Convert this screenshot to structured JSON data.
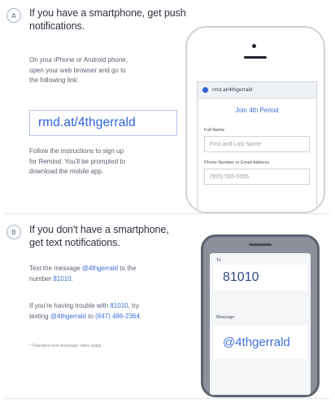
{
  "section_a": {
    "badge": "A",
    "heading_line1": "If you have a smartphone, get push",
    "heading_line2": "notifications.",
    "instr_line1": "On your iPhone or Android phone,",
    "instr_line2": "open your web browser and go to",
    "instr_line3": "the following link:",
    "link": "rmd.at/4thgerrald",
    "follow_line1": "Follow the instructions to sign up",
    "follow_line2": "for Remind. You'll be prompted to",
    "follow_line3": "download the mobile app.",
    "phone": {
      "url": "rmd.at/4thgerrald",
      "title": "Join 4th Period",
      "full_name_label": "Full Name",
      "full_name_placeholder": "First and Last Name",
      "contact_label": "Phone Number or Email Address",
      "contact_placeholder": "(555) 555-5555"
    }
  },
  "section_b": {
    "badge": "B",
    "heading_line1": "If you don't have a smartphone,",
    "heading_line2": "get text notifications.",
    "text_pre": "Text the message ",
    "text_code": "@4thgerrald",
    "text_mid": " to the",
    "number_pre": "number ",
    "number": "81010",
    "number_post": ".",
    "trouble_pre": "If you're having trouble with ",
    "trouble_number": "81010",
    "trouble_post": ", try",
    "texting_pre": "texting ",
    "texting_code": "@4thgerrald",
    "texting_mid": " to ",
    "texting_phone": "(847) 486-2364",
    "texting_post": ".",
    "fine_print": "* Standard text message rates apply.",
    "phone": {
      "to_label": "To",
      "to_value": "81010",
      "message_label": "Message",
      "message_value": "@4thgerrald"
    }
  }
}
